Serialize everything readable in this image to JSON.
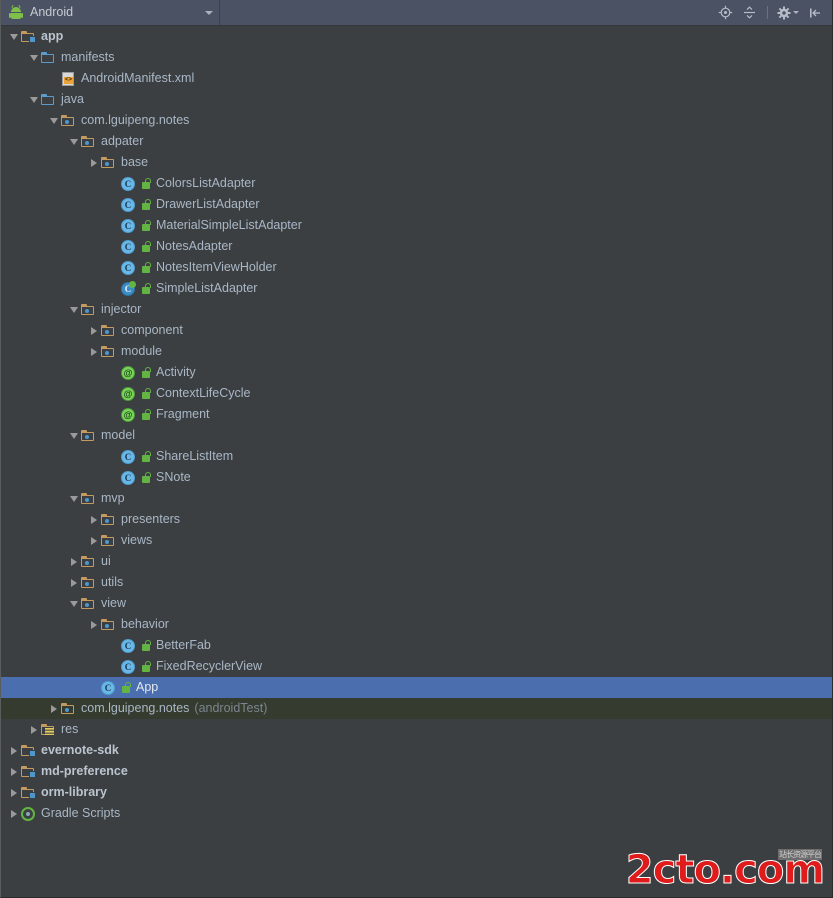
{
  "header": {
    "view_label": "Android",
    "android_icon": "android-robot-icon",
    "dropdown_icon": "chevron-down-icon",
    "actions": [
      {
        "name": "scroll-from-source-button",
        "icon": "target-crosshair-icon"
      },
      {
        "name": "collapse-all-button",
        "icon": "collapse-all-icon"
      },
      {
        "name": "settings-button",
        "icon": "gear-icon"
      },
      {
        "name": "hide-panel-button",
        "icon": "hide-left-icon"
      }
    ],
    "bar_color": "#4a5263"
  },
  "colors": {
    "background": "#3c3f41",
    "selection": "#4b6eaf",
    "test_source_background": "#353b2e",
    "text": "#a9b7c6",
    "muted_text": "#7d8590",
    "folder": "#c49a5f",
    "source_folder": "#5b9ccd",
    "class_icon": "#6ab7e8",
    "annotation_icon": "#79d65b",
    "public_badge": "#62b543"
  },
  "tree": [
    {
      "label": "app",
      "depth": 0,
      "twisty": "expanded",
      "icon": "module-folder-icon",
      "bold": true
    },
    {
      "label": "manifests",
      "depth": 1,
      "twisty": "expanded",
      "icon": "source-folder-icon",
      "bold": false
    },
    {
      "label": "AndroidManifest.xml",
      "depth": 2,
      "twisty": "none",
      "icon": "xml-file-icon",
      "bold": false
    },
    {
      "label": "java",
      "depth": 1,
      "twisty": "expanded",
      "icon": "source-folder-icon",
      "bold": false
    },
    {
      "label": "com.lguipeng.notes",
      "depth": 2,
      "twisty": "expanded",
      "icon": "package-folder-icon",
      "bold": false
    },
    {
      "label": "adpater",
      "depth": 3,
      "twisty": "expanded",
      "icon": "package-folder-icon",
      "bold": false
    },
    {
      "label": "base",
      "depth": 4,
      "twisty": "collapsed",
      "icon": "package-folder-icon",
      "bold": false
    },
    {
      "label": "ColorsListAdapter",
      "depth": 5,
      "twisty": "none",
      "icon": "class-icon",
      "badge": "public-badge",
      "bold": false
    },
    {
      "label": "DrawerListAdapter",
      "depth": 5,
      "twisty": "none",
      "icon": "class-icon",
      "badge": "public-badge",
      "bold": false
    },
    {
      "label": "MaterialSimpleListAdapter",
      "depth": 5,
      "twisty": "none",
      "icon": "class-icon",
      "badge": "public-badge",
      "bold": false
    },
    {
      "label": "NotesAdapter",
      "depth": 5,
      "twisty": "none",
      "icon": "class-icon",
      "badge": "public-badge",
      "bold": false
    },
    {
      "label": "NotesItemViewHolder",
      "depth": 5,
      "twisty": "none",
      "icon": "class-icon",
      "badge": "public-badge",
      "bold": false
    },
    {
      "label": "SimpleListAdapter",
      "depth": 5,
      "twisty": "none",
      "icon": "class-icon-alt",
      "badge": "public-badge",
      "bold": false
    },
    {
      "label": "injector",
      "depth": 3,
      "twisty": "expanded",
      "icon": "package-folder-icon",
      "bold": false
    },
    {
      "label": "component",
      "depth": 4,
      "twisty": "collapsed",
      "icon": "package-folder-icon",
      "bold": false
    },
    {
      "label": "module",
      "depth": 4,
      "twisty": "collapsed",
      "icon": "package-folder-icon",
      "bold": false
    },
    {
      "label": "Activity",
      "depth": 5,
      "twisty": "none",
      "icon": "annotation-icon",
      "badge": "public-badge",
      "bold": false
    },
    {
      "label": "ContextLifeCycle",
      "depth": 5,
      "twisty": "none",
      "icon": "annotation-icon",
      "badge": "public-badge",
      "bold": false
    },
    {
      "label": "Fragment",
      "depth": 5,
      "twisty": "none",
      "icon": "annotation-icon",
      "badge": "public-badge",
      "bold": false
    },
    {
      "label": "model",
      "depth": 3,
      "twisty": "expanded",
      "icon": "package-folder-icon",
      "bold": false
    },
    {
      "label": "ShareListItem",
      "depth": 5,
      "twisty": "none",
      "icon": "class-icon",
      "badge": "public-badge",
      "bold": false
    },
    {
      "label": "SNote",
      "depth": 5,
      "twisty": "none",
      "icon": "class-icon",
      "badge": "public-badge",
      "bold": false
    },
    {
      "label": "mvp",
      "depth": 3,
      "twisty": "expanded",
      "icon": "package-folder-icon",
      "bold": false
    },
    {
      "label": "presenters",
      "depth": 4,
      "twisty": "collapsed",
      "icon": "package-folder-icon",
      "bold": false
    },
    {
      "label": "views",
      "depth": 4,
      "twisty": "collapsed",
      "icon": "package-folder-icon",
      "bold": false
    },
    {
      "label": "ui",
      "depth": 3,
      "twisty": "collapsed",
      "icon": "package-folder-icon",
      "bold": false
    },
    {
      "label": "utils",
      "depth": 3,
      "twisty": "collapsed",
      "icon": "package-folder-icon",
      "bold": false
    },
    {
      "label": "view",
      "depth": 3,
      "twisty": "expanded",
      "icon": "package-folder-icon",
      "bold": false
    },
    {
      "label": "behavior",
      "depth": 4,
      "twisty": "collapsed",
      "icon": "package-folder-icon",
      "bold": false
    },
    {
      "label": "BetterFab",
      "depth": 5,
      "twisty": "none",
      "icon": "class-icon",
      "badge": "public-badge",
      "bold": false
    },
    {
      "label": "FixedRecyclerView",
      "depth": 5,
      "twisty": "none",
      "icon": "class-icon",
      "badge": "public-badge",
      "bold": false
    },
    {
      "label": "App",
      "depth": 4,
      "twisty": "none",
      "icon": "class-icon",
      "badge": "public-badge",
      "bold": false,
      "state": "selected"
    },
    {
      "label": "com.lguipeng.notes",
      "suffix": "(androidTest)",
      "depth": 2,
      "twisty": "collapsed",
      "icon": "package-folder-icon",
      "bold": false,
      "state": "test-source"
    },
    {
      "label": "res",
      "depth": 1,
      "twisty": "collapsed",
      "icon": "res-folder-icon",
      "bold": false
    },
    {
      "label": "evernote-sdk",
      "depth": 0,
      "twisty": "collapsed",
      "icon": "module-folder-icon",
      "bold": true
    },
    {
      "label": "md-preference",
      "depth": 0,
      "twisty": "collapsed",
      "icon": "module-folder-icon",
      "bold": true
    },
    {
      "label": "orm-library",
      "depth": 0,
      "twisty": "collapsed",
      "icon": "module-folder-icon",
      "bold": true
    },
    {
      "label": "Gradle Scripts",
      "depth": 0,
      "twisty": "collapsed",
      "icon": "gradle-icon",
      "bold": false
    }
  ],
  "watermark": {
    "text": "2cto.com",
    "badge": "站长资源平台",
    "color": "#e01b1b"
  }
}
